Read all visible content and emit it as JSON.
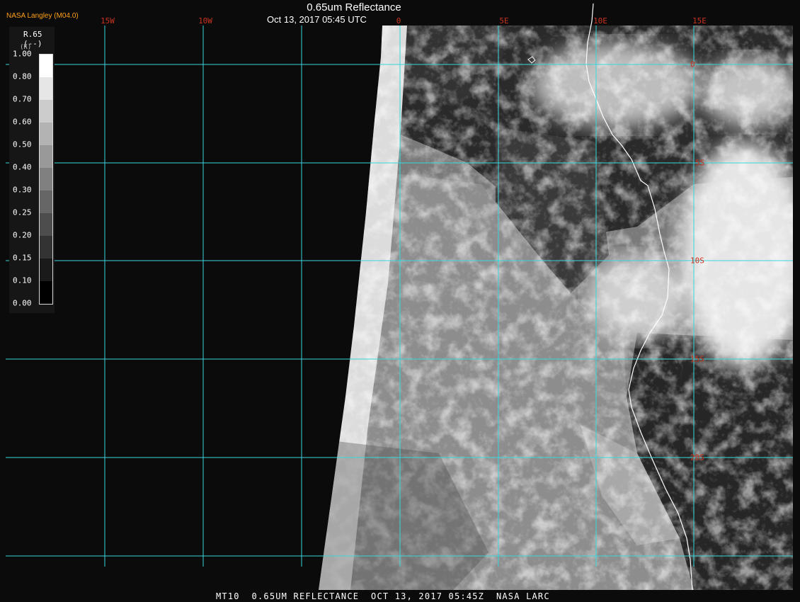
{
  "header": {
    "organization": "NASA Langley (M04.0)",
    "title": "0.65um Reflectance",
    "datetime": "Oct 13, 2017 05:45 UTC"
  },
  "footer": {
    "caption": "MT10  0.65UM REFLECTANCE  OCT 13, 2017 05:45Z  NASA LARC"
  },
  "legend": {
    "title": "R.65",
    "units": "(--)",
    "k_label": "(K)",
    "ticks": [
      "1.00",
      "0.80",
      "0.70",
      "0.60",
      "0.50",
      "0.40",
      "0.30",
      "0.25",
      "0.20",
      "0.15",
      "0.10",
      "0.00"
    ]
  },
  "grid": {
    "longitude_labels": [
      "15W",
      "10W",
      "0",
      "5E",
      "10E",
      "15E"
    ],
    "latitude_labels": [
      "0",
      "5S",
      "10S",
      "15S",
      "20S"
    ]
  },
  "colors": {
    "gridline": "#38d6dc",
    "grid_label": "#c8331f",
    "org_label": "#ffa11a",
    "coastline": "#ffffff",
    "background": "#000000"
  }
}
